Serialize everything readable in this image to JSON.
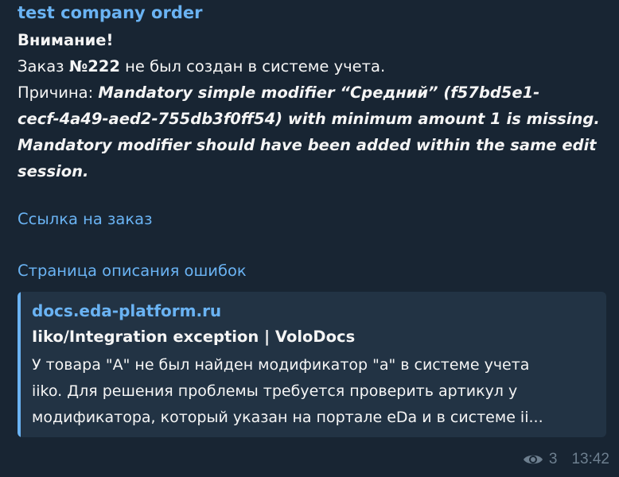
{
  "message": {
    "sender": "test company order",
    "title": "Внимание!",
    "order_prefix": "Заказ ",
    "order_number": "№222",
    "order_suffix": " не был создан в системе учета.",
    "reason_label": "Причина: ",
    "reason_line1": "Mandatory simple modifier “Средний” (f57bd5e1-",
    "reason_line2": "cecf-4a49-aed2-755db3f0ff54) with minimum amount 1 is missing.",
    "reason_line3": "Mandatory modifier should have been added within the same edit",
    "reason_line4": "session.",
    "order_link": "Ссылка на заказ",
    "errors_link": "Страница описания ошибок"
  },
  "preview": {
    "site": "docs.eda-platform.ru",
    "title": "Iiko/Integration exception | VoloDocs",
    "desc_line1": "У товара \"A\" не был найден модификатор \"a\" в системе учета",
    "desc_line2": "iiko. Для решения проблемы требуется проверить артикул у",
    "desc_line3": "модификатора, который указан на портале eDa и в системе ii..."
  },
  "meta": {
    "views_icon": "eye-icon",
    "views": "3",
    "time": "13:42"
  }
}
